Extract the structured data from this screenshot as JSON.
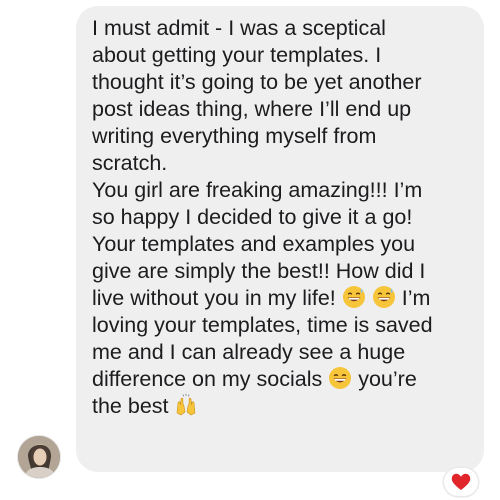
{
  "message": {
    "lines": [
      "I must admit - I was a sceptical",
      "about getting your templates. I",
      "thought it’s going to be yet another",
      "post ideas thing, where I’ll end up",
      "writing everything myself from",
      "scratch.",
      "You girl are freaking amazing!!! I’m",
      "so happy I decided to give it a go!",
      "Your templates and examples you",
      "give are simply the best!! How did I",
      "live without you in my life!",
      "I’m",
      "loving your templates, time is saved",
      "me and I can already see a huge",
      "difference on my socials",
      "you’re",
      "the best"
    ],
    "emoji": {
      "grin_sweat": "grinning-sweat-emoji",
      "smile": "beaming-smile-emoji",
      "hands": "raising-hands-emoji"
    }
  },
  "reaction": {
    "icon": "heart-icon",
    "color": "#e0252b"
  },
  "avatar": {
    "icon": "profile-photo"
  },
  "colors": {
    "bubble": "#efeff0",
    "text": "#1c1c1e"
  }
}
